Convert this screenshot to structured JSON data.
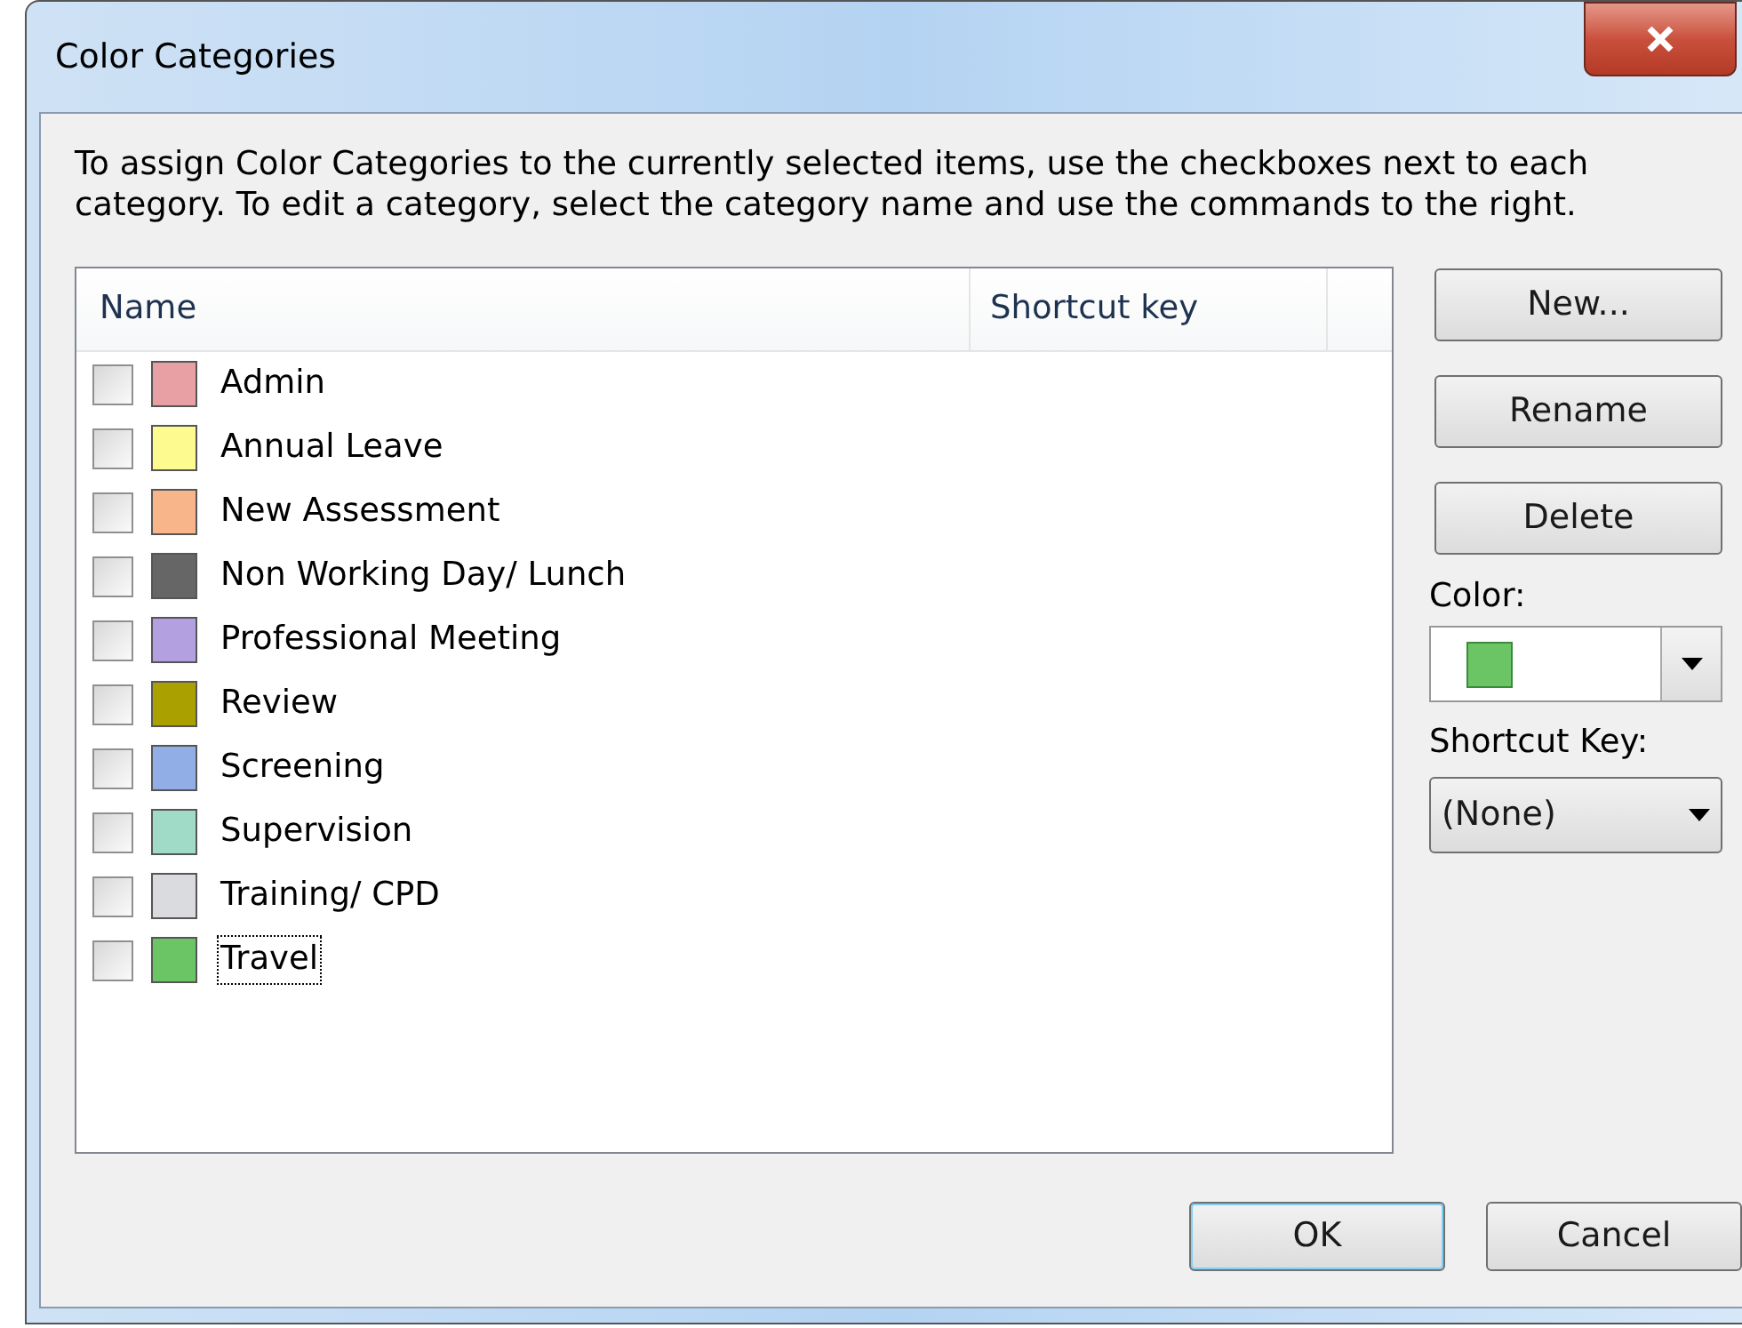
{
  "window": {
    "title": "Color Categories"
  },
  "instructions": "To assign Color Categories to the currently selected items, use the checkboxes next to each category.  To edit a category, select the category name and use the commands to the right.",
  "list": {
    "columns": [
      "Name",
      "Shortcut key"
    ],
    "items": [
      {
        "name": "Admin",
        "color": "#e8a0a4",
        "checked": false,
        "selected": false
      },
      {
        "name": "Annual Leave",
        "color": "#fdfa90",
        "checked": false,
        "selected": false
      },
      {
        "name": "New Assessment",
        "color": "#f7b589",
        "checked": false,
        "selected": false
      },
      {
        "name": "Non Working Day/ Lunch",
        "color": "#666666",
        "checked": false,
        "selected": false
      },
      {
        "name": "Professional Meeting",
        "color": "#b3a0e0",
        "checked": false,
        "selected": false
      },
      {
        "name": "Review",
        "color": "#aaa100",
        "checked": false,
        "selected": false
      },
      {
        "name": "Screening",
        "color": "#92aee6",
        "checked": false,
        "selected": false
      },
      {
        "name": "Supervision",
        "color": "#9fdbc7",
        "checked": false,
        "selected": false
      },
      {
        "name": "Training/ CPD",
        "color": "#dadbdf",
        "checked": false,
        "selected": false
      },
      {
        "name": "Travel",
        "color": "#6bc565",
        "checked": false,
        "selected": true
      }
    ]
  },
  "side_buttons": [
    "New...",
    "Rename",
    "Delete"
  ],
  "color_field": {
    "label": "Color:",
    "color": "#6bc565"
  },
  "shortcut_field": {
    "label": "Shortcut Key:",
    "value": "(None)"
  },
  "buttons": [
    {
      "label": "OK",
      "default": true
    },
    {
      "label": "Cancel",
      "default": false
    }
  ]
}
